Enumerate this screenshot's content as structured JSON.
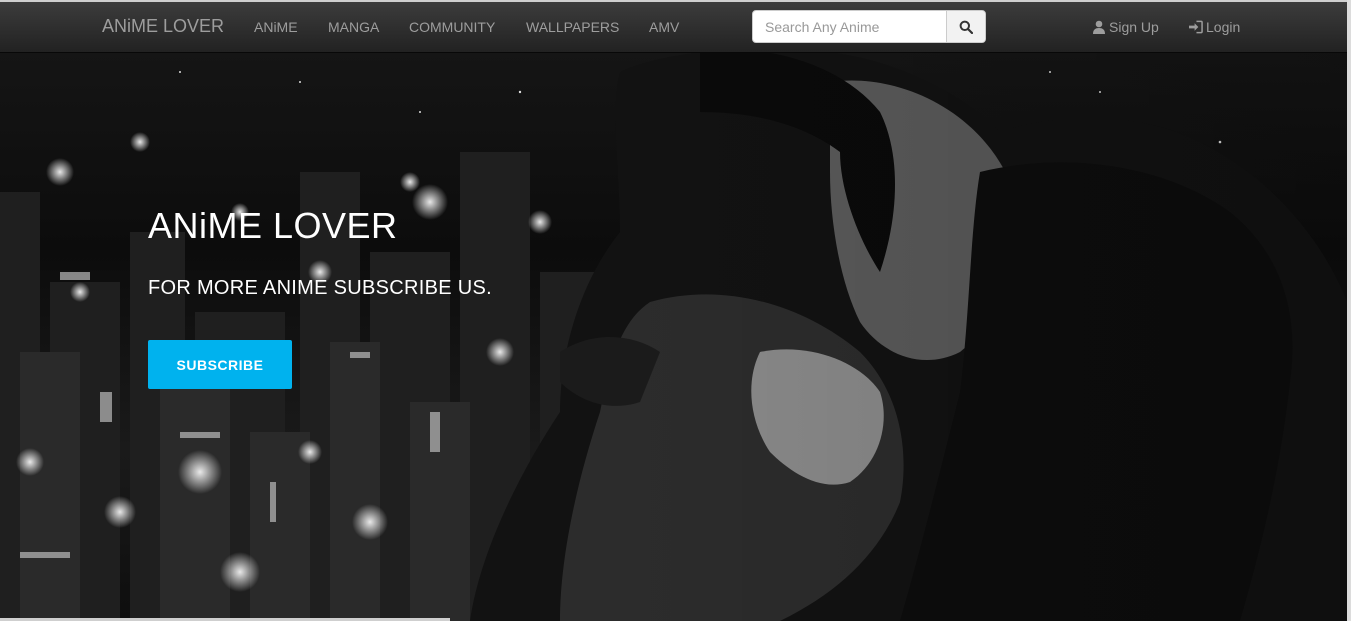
{
  "navbar": {
    "brand": "ANiME LOVER",
    "links": [
      "ANiME",
      "MANGA",
      "COMMUNITY",
      "WALLPAPERS",
      "AMV"
    ],
    "search": {
      "placeholder": "Search Any Anime"
    },
    "signup_label": "Sign Up",
    "login_label": "Login"
  },
  "hero": {
    "title": "ANiME LOVER",
    "subtitle": "FOR MORE ANIME SUBSCRIBE US.",
    "button_label": "SUBSCRIBE"
  },
  "icons": {
    "search": "search-icon",
    "signup": "user-icon",
    "login": "login-icon"
  },
  "colors": {
    "accent": "#00b2ee",
    "navbar": "#222222",
    "nav_text": "#9d9d9d"
  }
}
